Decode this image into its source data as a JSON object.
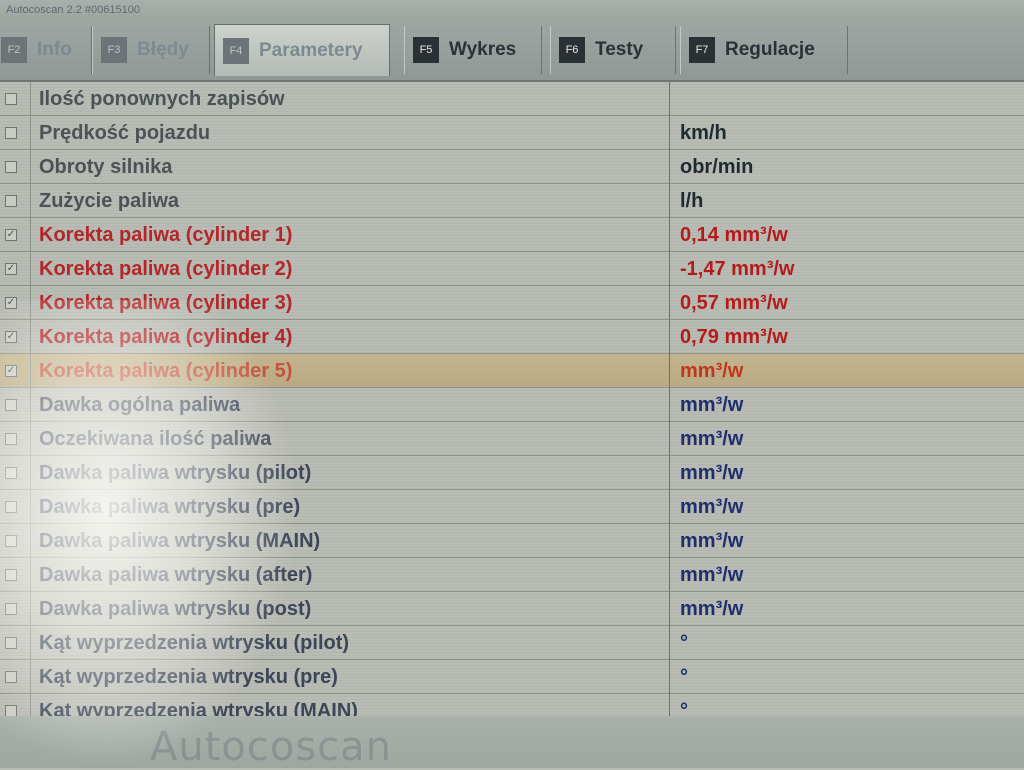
{
  "window": {
    "title": "Autocoscan 2.2 #00615100"
  },
  "tabs": [
    {
      "key": "F2",
      "label": "Info"
    },
    {
      "key": "F3",
      "label": "Błędy"
    },
    {
      "key": "F4",
      "label": "Parametery"
    },
    {
      "key": "F5",
      "label": "Wykres"
    },
    {
      "key": "F6",
      "label": "Testy"
    },
    {
      "key": "F7",
      "label": "Regulacje"
    }
  ],
  "params": [
    {
      "name": "Ilość ponownych zapisów",
      "value": "",
      "checked": false
    },
    {
      "name": "Prędkość pojazdu",
      "value": "km/h",
      "checked": false
    },
    {
      "name": "Obroty silnika",
      "value": "obr/min",
      "checked": false
    },
    {
      "name": "Zużycie paliwa",
      "value": "l/h",
      "checked": false
    },
    {
      "name": "Korekta paliwa (cylinder 1)",
      "value": "0,14 mm³/w",
      "checked": true
    },
    {
      "name": "Korekta paliwa (cylinder 2)",
      "value": "-1,47 mm³/w",
      "checked": true
    },
    {
      "name": "Korekta paliwa (cylinder 3)",
      "value": "0,57 mm³/w",
      "checked": true
    },
    {
      "name": "Korekta paliwa (cylinder 4)",
      "value": "0,79 mm³/w",
      "checked": true
    },
    {
      "name": "Korekta paliwa (cylinder 5)",
      "value": "mm³/w",
      "checked": true
    },
    {
      "name": "Dawka ogólna paliwa",
      "value": "mm³/w",
      "checked": false
    },
    {
      "name": "Oczekiwana ilość paliwa",
      "value": "mm³/w",
      "checked": false
    },
    {
      "name": "Dawka paliwa wtrysku (pilot)",
      "value": "mm³/w",
      "checked": false
    },
    {
      "name": "Dawka paliwa wtrysku (pre)",
      "value": "mm³/w",
      "checked": false
    },
    {
      "name": "Dawka paliwa wtrysku (MAIN)",
      "value": "mm³/w",
      "checked": false
    },
    {
      "name": "Dawka paliwa wtrysku (after)",
      "value": "mm³/w",
      "checked": false
    },
    {
      "name": "Dawka paliwa wtrysku (post)",
      "value": "mm³/w",
      "checked": false
    },
    {
      "name": "Kąt wyprzedzenia wtrysku (pilot)",
      "value": "°",
      "checked": false
    },
    {
      "name": "Kąt wyprzedzenia wtrysku (pre)",
      "value": "°",
      "checked": false
    },
    {
      "name": "Kąt wyprzedzenia wtrysku (MAIN)",
      "value": "°",
      "checked": false
    }
  ],
  "footer": {
    "brand": "Autocoscan"
  }
}
